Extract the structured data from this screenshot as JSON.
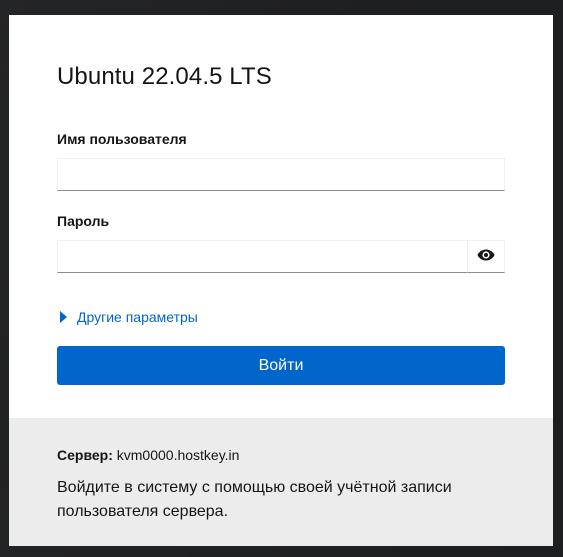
{
  "login": {
    "title": "Ubuntu 22.04.5 LTS",
    "username_label": "Имя пользователя",
    "username_value": "",
    "password_label": "Пароль",
    "password_value": "",
    "show_password_icon": "eye-icon",
    "other_options_label": "Другие параметры",
    "login_button_label": "Войти"
  },
  "footer": {
    "server_key": "Сервер:",
    "server_value": "kvm0000.hostkey.in",
    "hint": "Войдите в систему с помощью своей учётной записи пользователя сервера."
  },
  "colors": {
    "accent": "#0066cc",
    "background": "#1d1e20",
    "footer_bg": "#ececec"
  }
}
